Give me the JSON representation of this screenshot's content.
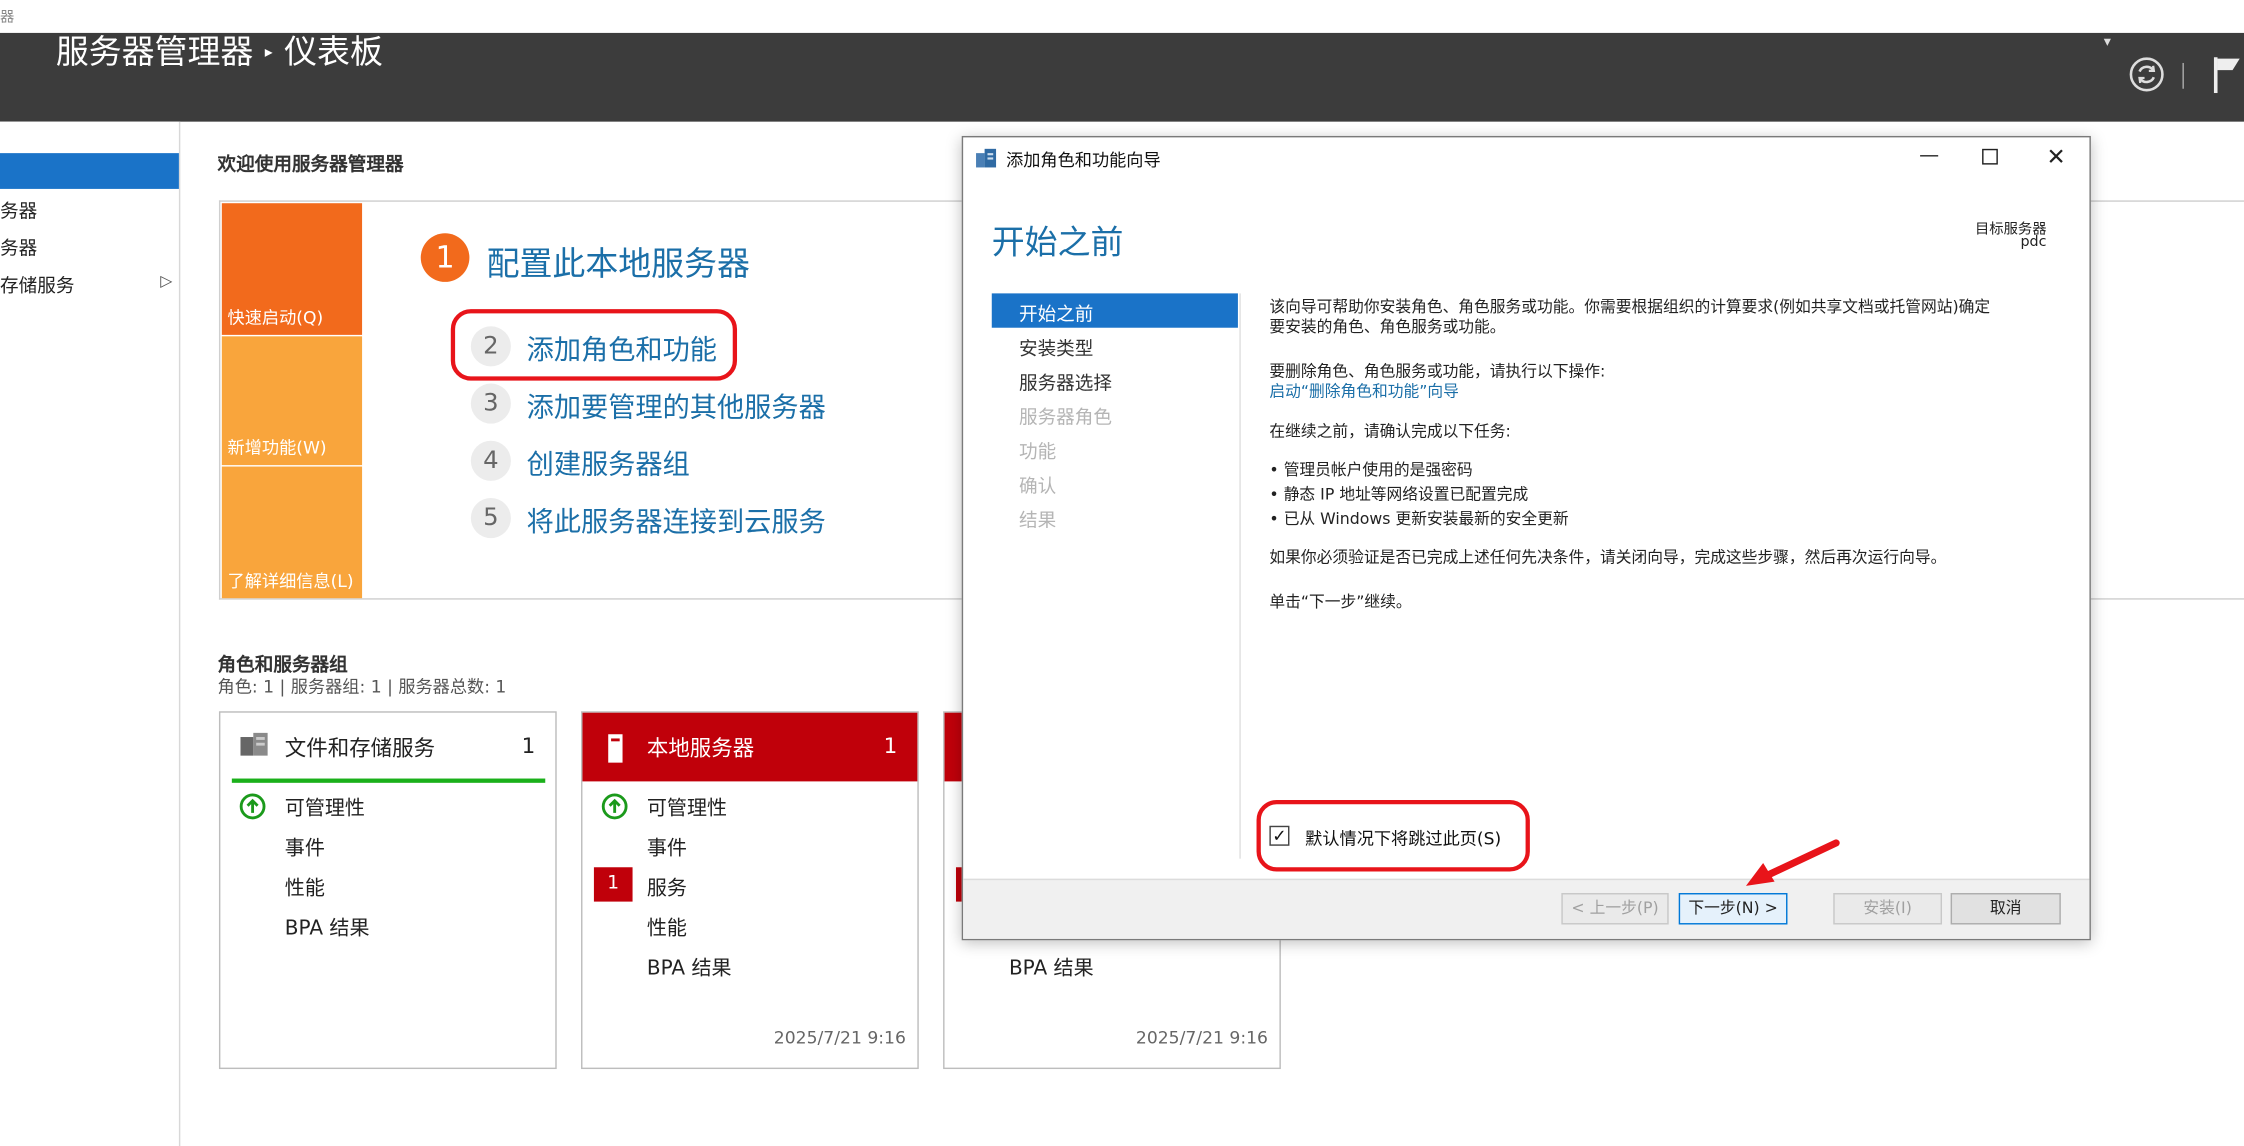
{
  "window": {
    "top_strip_text": "器",
    "app_title": "服务器管理器",
    "page_title": "仪表板"
  },
  "sidebar": {
    "items": [
      {
        "label": ""
      },
      {
        "label": "务器"
      },
      {
        "label": "务器"
      },
      {
        "label": "存储服务"
      }
    ]
  },
  "welcome": {
    "title": "欢迎使用服务器管理器",
    "tiles": {
      "quick_start": "快速启动(Q)",
      "whats_new": "新增功能(W)",
      "learn_more": "了解详细信息(L)"
    },
    "steps": [
      {
        "num": "1",
        "label": "配置此本地服务器"
      },
      {
        "num": "2",
        "label": "添加角色和功能"
      },
      {
        "num": "3",
        "label": "添加要管理的其他服务器"
      },
      {
        "num": "4",
        "label": "创建服务器组"
      },
      {
        "num": "5",
        "label": "将此服务器连接到云服务"
      }
    ]
  },
  "roles": {
    "title": "角色和服务器组",
    "subtitle": "角色: 1 | 服务器组: 1 | 服务器总数: 1",
    "cards": [
      {
        "title": "文件和存储服务",
        "count": "1",
        "rows": [
          "可管理性",
          "事件",
          "性能",
          "BPA 结果"
        ],
        "date": ""
      },
      {
        "title": "本地服务器",
        "count": "1",
        "rows": [
          "可管理性",
          "事件",
          "服务",
          "性能",
          "BPA 结果"
        ],
        "service_badge": "1",
        "date": "2025/7/21 9:16"
      },
      {
        "title": "",
        "count": "",
        "rows": [
          "BPA 结果"
        ],
        "date": "2025/7/21 9:16"
      }
    ]
  },
  "dialog": {
    "title": "添加角色和功能向导",
    "heading": "开始之前",
    "target_label": "目标服务器",
    "target_value": "pdc",
    "nav": [
      {
        "label": "开始之前",
        "state": "active"
      },
      {
        "label": "安装类型",
        "state": "normal"
      },
      {
        "label": "服务器选择",
        "state": "normal"
      },
      {
        "label": "服务器角色",
        "state": "disabled"
      },
      {
        "label": "功能",
        "state": "disabled"
      },
      {
        "label": "确认",
        "state": "disabled"
      },
      {
        "label": "结果",
        "state": "disabled"
      }
    ],
    "body": {
      "intro_line1": "该向导可帮助你安装角色、角色服务或功能。你需要根据组织的计算要求(例如共享文档或托管网站)确定",
      "intro_line2": "要安装的角色、角色服务或功能。",
      "remove_line": "要删除角色、角色服务或功能，请执行以下操作:",
      "remove_link": "启动“删除角色和功能”向导",
      "before_line": "在继续之前，请确认完成以下任务:",
      "bullets": [
        "• 管理员帐户使用的是强密码",
        "• 静态 IP 地址等网络设置已配置完成",
        "• 已从 Windows 更新安装最新的安全更新"
      ],
      "verify_line": "如果你必须验证是否已完成上述任何先决条件，请关闭向导，完成这些步骤，然后再次运行向导。",
      "next_line": "单击“下一步”继续。"
    },
    "skip_checkbox": {
      "label": "默认情况下将跳过此页(S)",
      "checked": true,
      "mark": "✓"
    },
    "buttons": {
      "previous": "< 上一步(P)",
      "next": "下一步(N) >",
      "install": "安装(I)",
      "cancel": "取消"
    }
  },
  "colors": {
    "accent_blue": "#1b6fa8",
    "selection_blue": "#1a73c8",
    "orange": "#f26a1c",
    "light_orange": "#f9a53c",
    "server_red": "#c0000a",
    "highlight_red": "#e8141a",
    "header_bg": "#3c3c3c"
  }
}
